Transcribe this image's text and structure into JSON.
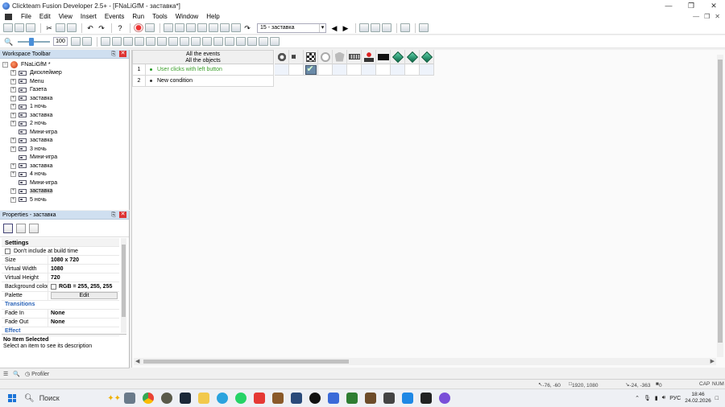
{
  "window": {
    "title": "Clickteam Fusion Developer 2.5+ - [FNaLiGfM - заставка*]",
    "controls": {
      "minimize": "—",
      "restore": "❐",
      "close": "✕"
    },
    "mdi_controls": {
      "minimize": "—",
      "restore": "❐",
      "close": "✕"
    }
  },
  "menu": {
    "items": [
      "File",
      "Edit",
      "View",
      "Insert",
      "Events",
      "Run",
      "Tools",
      "Window",
      "Help"
    ]
  },
  "toolbar": {
    "frame_selector": "15 - заставка",
    "zoom_value": "100"
  },
  "workspace": {
    "title": "Workspace Toolbar",
    "root": "FNaLiGfM *",
    "frames": [
      {
        "label": "Дисклеймер",
        "expandable": true
      },
      {
        "label": "Menu",
        "expandable": true
      },
      {
        "label": "Газета",
        "expandable": true
      },
      {
        "label": "заставка",
        "expandable": true
      },
      {
        "label": "1 ночь",
        "expandable": true
      },
      {
        "label": "заставка",
        "expandable": true
      },
      {
        "label": "2 ночь",
        "expandable": true
      },
      {
        "label": "Мини-игра",
        "expandable": false
      },
      {
        "label": "заставка",
        "expandable": true
      },
      {
        "label": "3 ночь",
        "expandable": true
      },
      {
        "label": "Мини-игра",
        "expandable": false
      },
      {
        "label": "заставка",
        "expandable": true
      },
      {
        "label": "4 ночь",
        "expandable": true
      },
      {
        "label": "Мини-игра",
        "expandable": false
      },
      {
        "label": "заставка",
        "expandable": true,
        "selected": true
      },
      {
        "label": "5 ночь",
        "expandable": true
      }
    ]
  },
  "properties": {
    "title": "Properties - заставка",
    "settings_label": "Settings",
    "dont_include_label": "Don't include at build time",
    "rows": [
      {
        "key": "Size",
        "value": "1080 x 720"
      },
      {
        "key": "Virtual Width",
        "value": "1080"
      },
      {
        "key": "Virtual Height",
        "value": "720"
      }
    ],
    "background_color_label": "Background color",
    "background_color_value": "RGB = 255, 255, 255",
    "palette_label": "Palette",
    "palette_button": "Edit",
    "transitions_label": "Transitions",
    "fade_in_label": "Fade In",
    "fade_in_value": "None",
    "fade_out_label": "Fade Out",
    "fade_out_value": "None",
    "effect_label": "Effect",
    "description_title": "No Item Selected",
    "description_text": "Select an item to see its description"
  },
  "bottom_tabs": {
    "profiler": "Profiler"
  },
  "event_editor": {
    "header_line1": "All the events",
    "header_line2": "All the objects",
    "rows": [
      {
        "num": "1",
        "condition": "User clicks with left button"
      },
      {
        "num": "2",
        "condition": "New condition"
      }
    ]
  },
  "statusbar": {
    "mouse": "-76, -60",
    "size": "1920, 1080",
    "offset": "-24, -363",
    "count": "0",
    "caps": "CAP",
    "num": "NUM"
  },
  "taskbar": {
    "search_label": "Поиск",
    "language": "РУС",
    "time": "18:46",
    "date": "24.02.2026"
  },
  "colors": {
    "accent": "#2a63b8",
    "condition_green": "#3a9e2a",
    "panel_header": "#cfdff0"
  }
}
